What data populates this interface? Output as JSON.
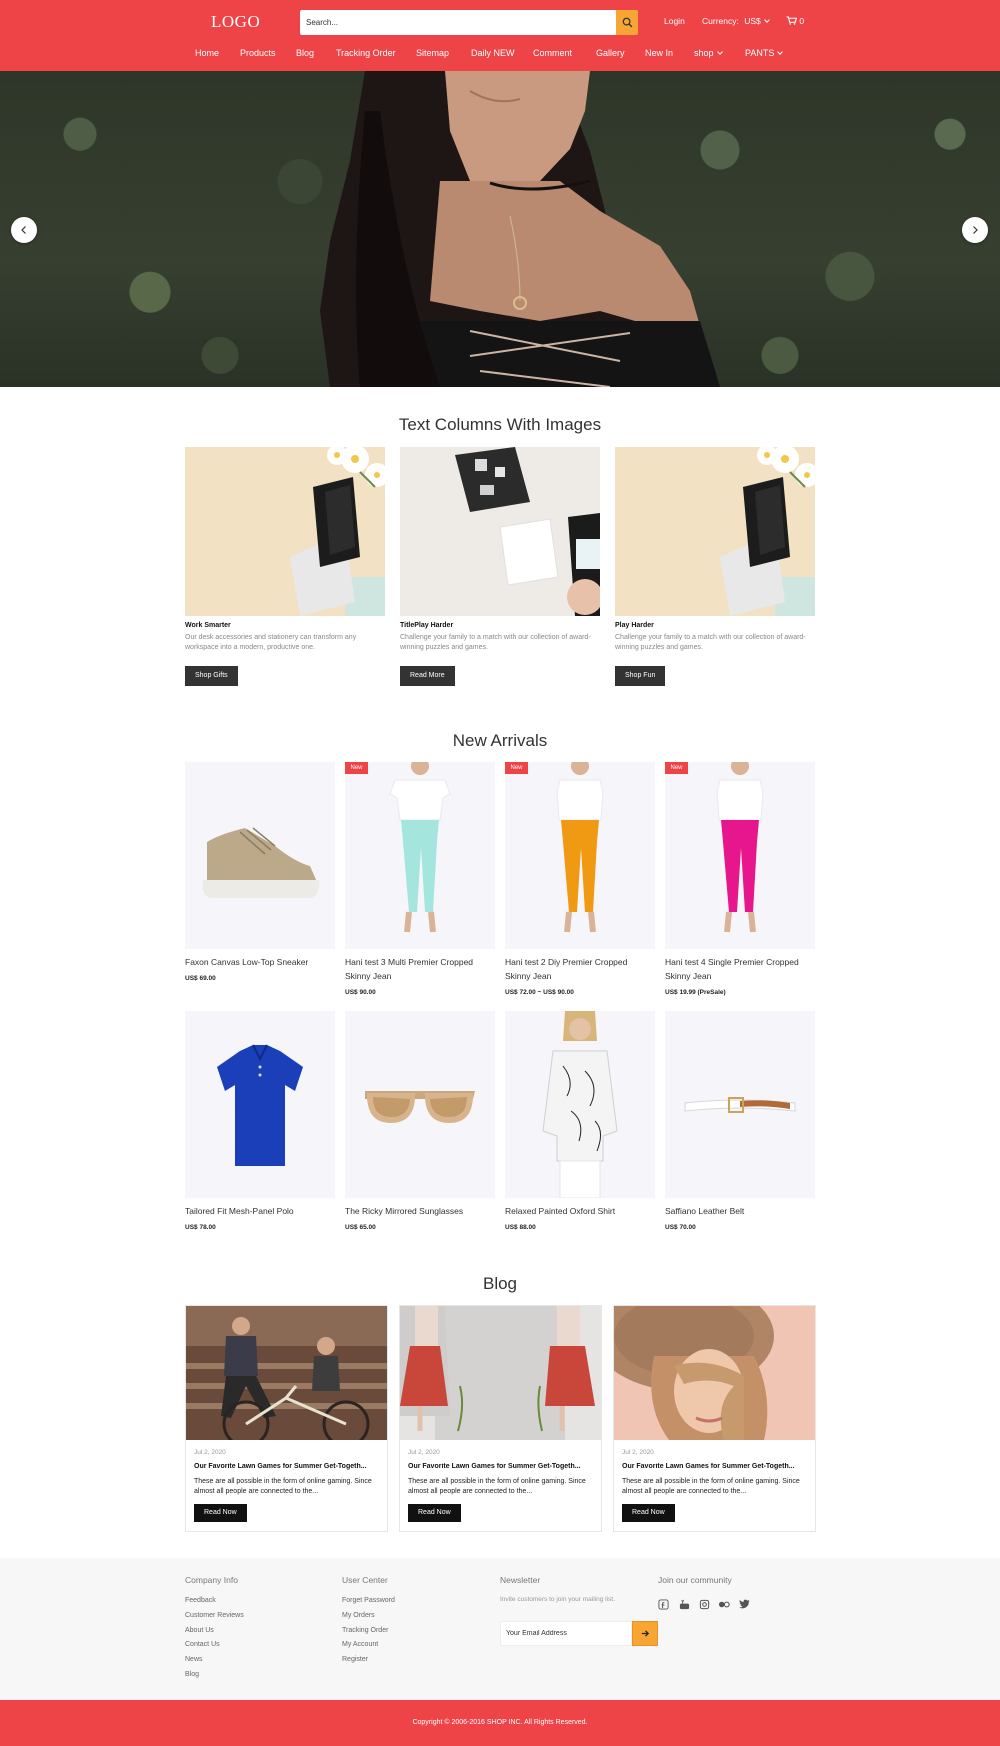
{
  "header": {
    "logo": "LOGO",
    "search_placeholder": "Search...",
    "login": "Login",
    "currency_label": "Currency:",
    "currency_value": "US$",
    "cart_count": "0",
    "brand_color": "#ee4347",
    "accent_color": "#f7a533"
  },
  "nav": [
    "Home",
    "Products",
    "Blog",
    "Tracking Order",
    "Sitemap",
    "Daily NEW",
    "Comment",
    "Gallery",
    "New In",
    "shop",
    "PANTS"
  ],
  "text_columns": {
    "title": "Text Columns With Images",
    "items": [
      {
        "title": "Work Smarter",
        "text": "Our desk accessories and stationery can transform any workspace into a modern, productive one.",
        "button": "Shop Gifts"
      },
      {
        "title": "TitlePlay Harder",
        "text": "Challenge your family to a match with our collection of award-winning puzzles and games.",
        "button": "Read More"
      },
      {
        "title": "Play Harder",
        "text": "Challenge your family to a match with our collection of award-winning puzzles and games.",
        "button": "Shop Fun"
      }
    ]
  },
  "new_arrivals": {
    "title": "New Arrivals",
    "badge": "New",
    "products": [
      {
        "name": "Faxon Canvas Low-Top Sneaker",
        "price": "US$ 69.00",
        "new": false
      },
      {
        "name": "Hani test 3 Multi Premier Cropped Skinny Jean",
        "price": "US$ 90.00",
        "new": true
      },
      {
        "name": "Hani test 2 Diy Premier Cropped Skinny Jean",
        "price": "US$ 72.00 ~ US$ 90.00",
        "new": true
      },
      {
        "name": "Hani test 4 Single Premier Cropped Skinny Jean",
        "price": "US$ 19.99 (PreSale)",
        "new": true
      },
      {
        "name": "Tailored Fit Mesh-Panel Polo",
        "price": "US$ 78.00",
        "new": false
      },
      {
        "name": "The Ricky Mirrored Sunglasses",
        "price": "US$ 65.00",
        "new": false
      },
      {
        "name": "Relaxed Painted Oxford Shirt",
        "price": "US$ 88.00",
        "new": false
      },
      {
        "name": "Saffiano Leather Belt",
        "price": "US$ 70.00",
        "new": false
      }
    ]
  },
  "blog": {
    "title": "Blog",
    "posts": [
      {
        "date": "Jul 2, 2020",
        "title": "Our Favorite Lawn Games for Summer Get-Togeth...",
        "text": "These are all possible in the form of online gaming. Since almost all people are connected to the...",
        "button": "Read Now"
      },
      {
        "date": "Jul 2, 2020",
        "title": "Our Favorite Lawn Games for Summer Get-Togeth...",
        "text": "These are all possible in the form of online gaming. Since almost all people are connected to the...",
        "button": "Read Now"
      },
      {
        "date": "Jul 2, 2020",
        "title": "Our Favorite Lawn Games for Summer Get-Togeth...",
        "text": "These are all possible in the form of online gaming. Since almost all people are connected to the...",
        "button": "Read Now"
      }
    ]
  },
  "footer": {
    "company_info": {
      "title": "Company Info",
      "links": [
        "Feedback",
        "Customer Reviews",
        "About Us",
        "Contact Us",
        "News",
        "Blog"
      ]
    },
    "user_center": {
      "title": "User Center",
      "links": [
        "Forget Password",
        "My Orders",
        "Tracking Order",
        "My Account",
        "Register"
      ]
    },
    "newsletter": {
      "title": "Newsletter",
      "text": "Invite customers to join your mailing list.",
      "placeholder": "Your Email Address"
    },
    "community": {
      "title": "Join our community",
      "icons": [
        "facebook-icon",
        "youtube-icon",
        "instagram-icon",
        "flickr-icon",
        "twitter-icon"
      ]
    },
    "copyright": "Copyright © 2006-2016 SHOP INC. All Rights Reserved."
  }
}
